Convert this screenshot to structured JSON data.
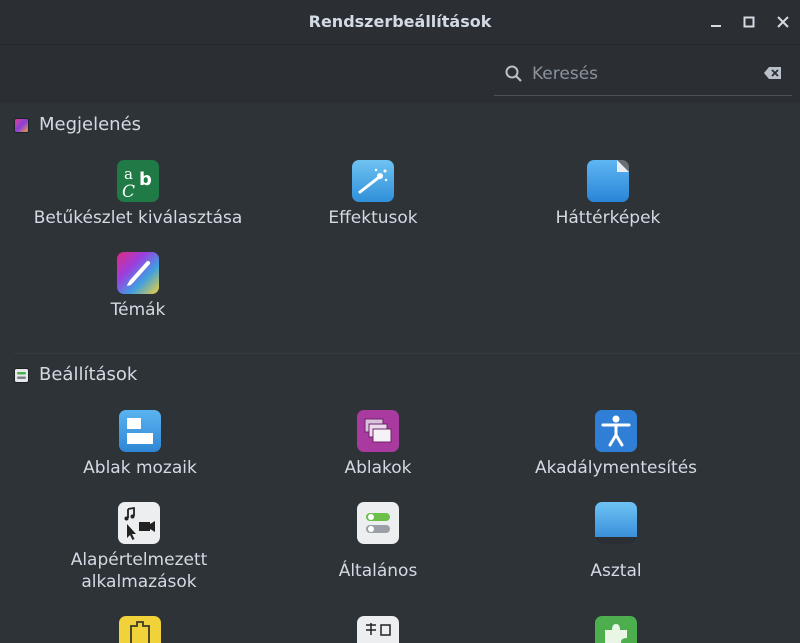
{
  "window": {
    "title": "Rendszerbeállítások"
  },
  "search": {
    "placeholder": "Keresés",
    "value": ""
  },
  "sections": [
    {
      "label": "Megjelenés",
      "items": [
        {
          "label": "Betűkészlet kiválasztása",
          "icon": "font-selection-icon"
        },
        {
          "label": "Effektusok",
          "icon": "effects-icon"
        },
        {
          "label": "Háttérképek",
          "icon": "backgrounds-icon"
        },
        {
          "label": "Témák",
          "icon": "themes-icon"
        }
      ]
    },
    {
      "label": "Beállítások",
      "items": [
        {
          "label": "Ablak mozaik",
          "icon": "window-tiling-icon"
        },
        {
          "label": "Ablakok",
          "icon": "windows-icon"
        },
        {
          "label": "Akadálymentesítés",
          "icon": "accessibility-icon"
        },
        {
          "label": "Alapértelmezett alkalmazások",
          "line1": "Alapértelmezett",
          "line2": "alkalmazások",
          "icon": "preferred-applications-icon"
        },
        {
          "label": "Általános",
          "icon": "general-icon"
        },
        {
          "label": "Asztal",
          "icon": "desktop-icon"
        }
      ]
    }
  ],
  "partial_icons": [
    "applets-icon",
    "input-method-icon",
    "extensions-icon"
  ],
  "colors": {
    "bg": "#2e3338",
    "header": "#2b2f34",
    "text": "#d3dae3"
  }
}
